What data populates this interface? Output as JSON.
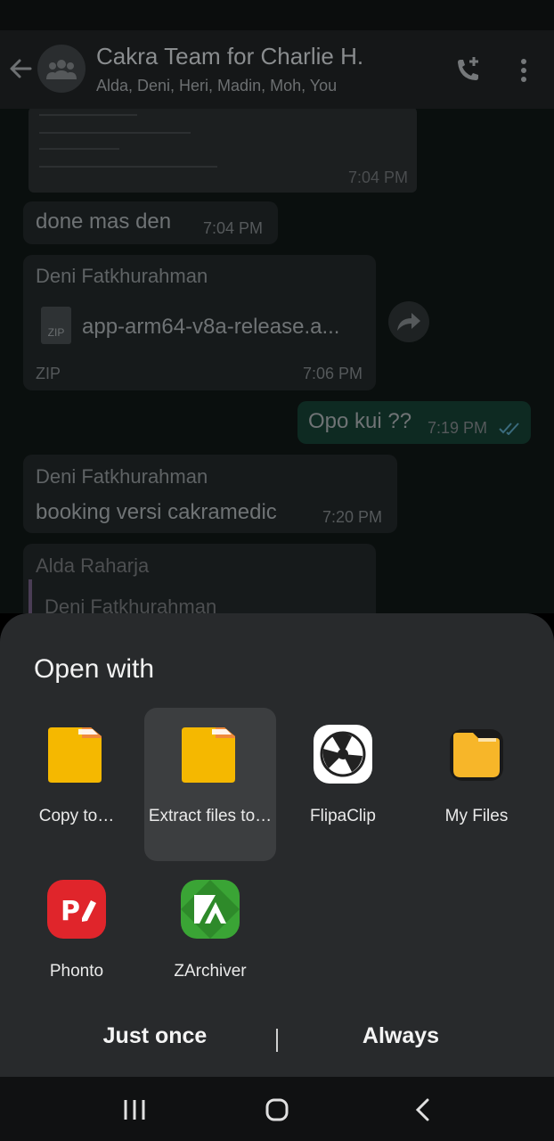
{
  "chat": {
    "title": "Cakra Team for Charlie H.",
    "subtitle": "Alda, Deni, Heri, Madin, Moh, You",
    "icons": [
      "back-arrow-icon",
      "group-icon",
      "add-call-icon",
      "more-vert-icon"
    ],
    "messages": {
      "image_time": "7:04 PM",
      "msg1_text": "done mas den",
      "msg1_time": "7:04 PM",
      "file_sender": "Deni Fatkhurahman",
      "file_icon_text": "ZIP",
      "file_name": "app-arm64-v8a-release.a...",
      "file_type": "ZIP",
      "file_time": "7:06 PM",
      "out_text": "Opo kui ??",
      "out_time": "7:19 PM",
      "msg3_sender": "Deni Fatkhurahman",
      "msg3_text": "booking versi cakramedic",
      "msg3_time": "7:20 PM",
      "msg4_sender": "Alda Raharja",
      "msg4_quote_sender": "Deni Fatkhurahman"
    }
  },
  "sheet": {
    "title": "Open with",
    "apps": [
      {
        "label": "Copy to…",
        "icon": "folder-icon",
        "selected": false
      },
      {
        "label": "Extract files to…",
        "icon": "folder-icon",
        "selected": true
      },
      {
        "label": "FlipaClip",
        "icon": "flipaclip-icon",
        "selected": false
      },
      {
        "label": "My Files",
        "icon": "my-files-icon",
        "selected": false
      },
      {
        "label": "Phonto",
        "icon": "phonto-icon",
        "selected": false
      },
      {
        "label": "ZArchiver",
        "icon": "zarchiver-icon",
        "selected": false
      }
    ],
    "just_once": "Just once",
    "always": "Always"
  },
  "nav": {
    "icons": [
      "recent-apps-icon",
      "home-icon",
      "back-icon"
    ]
  },
  "colors": {
    "sheet_bg": "#282a2c",
    "folder_yellow": "#f5b800",
    "phonto_red": "#e0252b",
    "zarchiver_green": "#3aa435"
  }
}
